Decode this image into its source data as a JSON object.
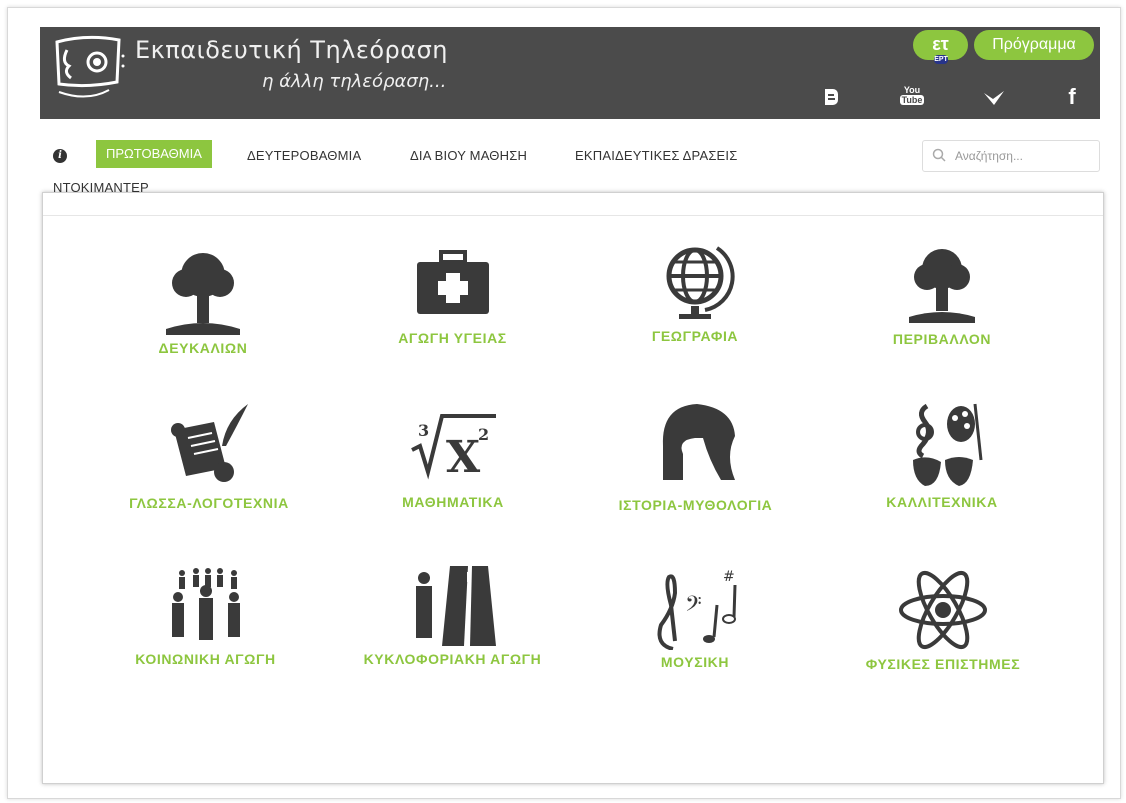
{
  "header": {
    "title": "Εκπαιδευτική Τηλεόραση",
    "subtitle": "η άλλη τηλεόραση...",
    "ert_badge": "ετ",
    "ert_small": "ΕΡΤ",
    "program_button": "Πρόγραμμα",
    "social_icons": [
      "blogger-icon",
      "youtube-icon",
      "bird-icon",
      "facebook-icon"
    ],
    "youtube_text": [
      "You",
      "Tube"
    ],
    "facebook_text": "f"
  },
  "nav": {
    "info_icon": "i",
    "items": [
      "ΠΡΩΤΟΒΑΘΜΙΑ",
      "ΔΕΥΤΕΡΟΒΑΘΜΙΑ",
      "ΔΙΑ ΒΙΟΥ ΜΑΘΗΣΗ",
      "ΕΚΠΑΙΔΕΥΤΙΚΕΣ ΔΡΑΣΕΙΣ",
      "ΝΤΟΚΙΜΑΝΤΕΡ"
    ],
    "active": "ΠΡΩΤΟΒΑΘΜΙΑ",
    "search_placeholder": "Αναζήτηση..."
  },
  "categories": [
    {
      "label": "ΔΕΥΚΑΛΙΩΝ",
      "icon": "tree-icon"
    },
    {
      "label": "ΑΓΩΓΗ ΥΓΕΙΑΣ",
      "icon": "first-aid-kit-icon"
    },
    {
      "label": "ΓΕΩΓΡΑΦΙΑ",
      "icon": "globe-icon"
    },
    {
      "label": "ΠΕΡΙΒΑΛΛΟΝ",
      "icon": "tree-icon"
    },
    {
      "label": "ΓΛΩΣΣΑ-ΛΟΓΟΤΕΧΝΙΑ",
      "icon": "scroll-quill-icon"
    },
    {
      "label": "ΜΑΘΗΜΑΤΙΚΑ",
      "icon": "math-root-icon",
      "math": {
        "index": "3",
        "base": "X",
        "exp": "2"
      }
    },
    {
      "label": "ΙΣΤΟΡΙΑ-ΜΥΘΟΛΟΓΙΑ",
      "icon": "spartan-helmet-icon"
    },
    {
      "label": "ΚΑΛΛΙΤΕΧΝΙΚΑ",
      "icon": "arts-masks-icon"
    },
    {
      "label": "ΚΟΙΝΩΝΙΚΗ ΑΓΩΓΗ",
      "icon": "people-group-icon"
    },
    {
      "label": "ΚΥΚΛΟΦΟΡΙΑΚΗ ΑΓΩΓΗ",
      "icon": "road-pedestrian-icon"
    },
    {
      "label": "ΜΟΥΣΙΚΗ",
      "icon": "music-notes-icon"
    },
    {
      "label": "ΦΥΣΙΚΕΣ ΕΠΙΣΤΗΜΕΣ",
      "icon": "atom-icon"
    }
  ],
  "colors": {
    "accent": "#8dc63f",
    "header_bg": "#4b4b4b",
    "icon": "#3a3a3a"
  }
}
